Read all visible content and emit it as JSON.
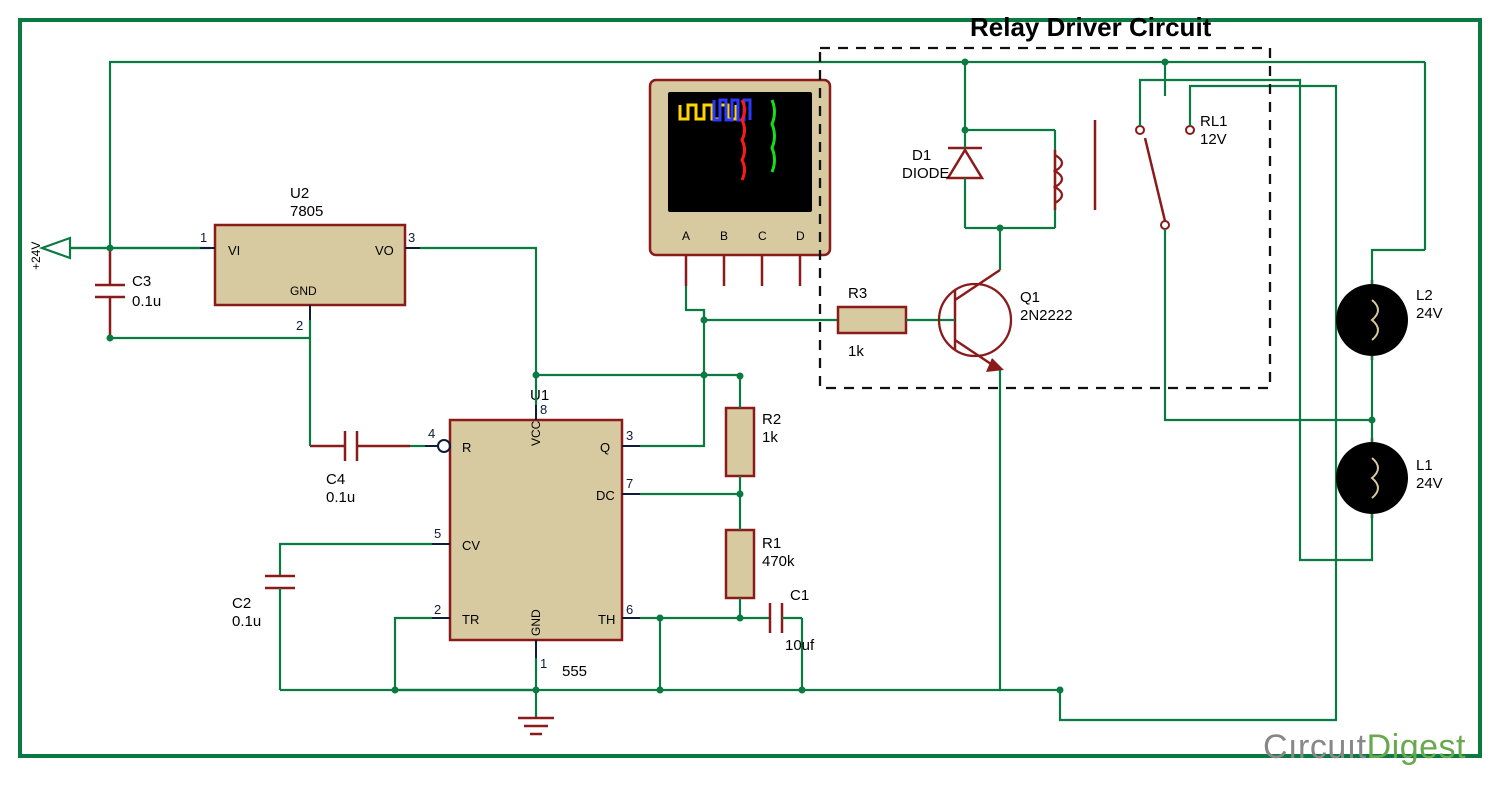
{
  "title": "Relay Driver Circuit",
  "voltage_rail": "+24V",
  "logo_main": "Cırcuıt",
  "logo_accent": "Digest",
  "scope": {
    "channels": [
      "A",
      "B",
      "C",
      "D"
    ]
  },
  "components": {
    "U2": {
      "ref": "U2",
      "part": "7805",
      "pins": {
        "1": "VI",
        "2": "GND",
        "3": "VO"
      }
    },
    "U1": {
      "ref": "U1",
      "part": "555",
      "pins": {
        "1": "GND",
        "2": "TR",
        "3": "Q",
        "4": "R",
        "5": "CV",
        "6": "TH",
        "7": "DC",
        "8": "VCC"
      }
    },
    "C1": {
      "ref": "C1",
      "value": "10uf"
    },
    "C2": {
      "ref": "C2",
      "value": "0.1u"
    },
    "C3": {
      "ref": "C3",
      "value": "0.1u"
    },
    "C4": {
      "ref": "C4",
      "value": "0.1u"
    },
    "R1": {
      "ref": "R1",
      "value": "470k"
    },
    "R2": {
      "ref": "R2",
      "value": "1k"
    },
    "R3": {
      "ref": "R3",
      "value": "1k"
    },
    "D1": {
      "ref": "D1",
      "value": "DIODE"
    },
    "Q1": {
      "ref": "Q1",
      "value": "2N2222"
    },
    "RL1": {
      "ref": "RL1",
      "value": "12V"
    },
    "L1": {
      "ref": "L1",
      "value": "24V"
    },
    "L2": {
      "ref": "L2",
      "value": "24V"
    }
  }
}
